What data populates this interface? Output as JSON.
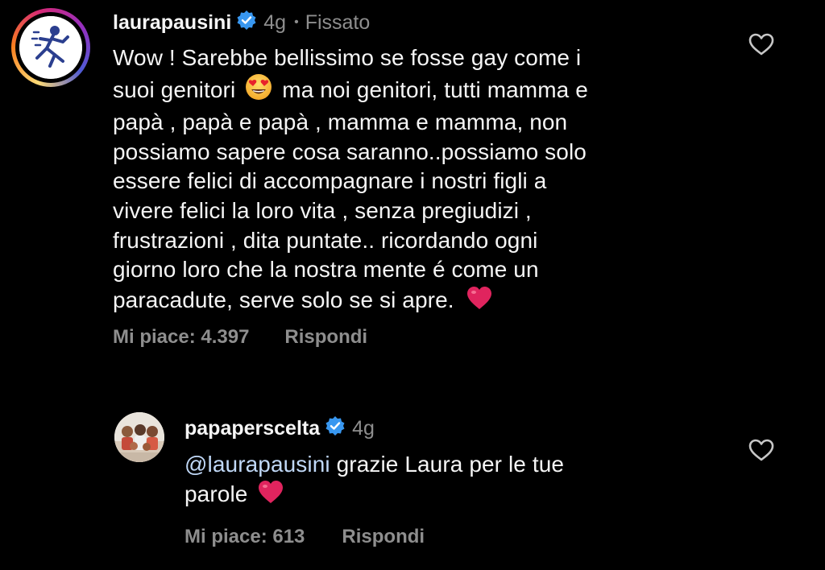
{
  "comments": [
    {
      "username": "laurapausini",
      "time": "4g",
      "separator": "•",
      "pinned_label": "Fissato",
      "text_lines": [
        "Wow ! Sarebbe bellissimo se fosse gay come i",
        "suoi genitori",
        "ma noi genitori, tutti mamma e",
        "papà , papà e papà , mamma e mamma, non",
        "possiamo sapere cosa saranno..possiamo solo",
        "essere felici di accompagnare i nostri figli a",
        "vivere felici la loro vita , senza pregiudizi ,",
        "frustrazioni , dita puntate.. ricordando ogni",
        "giorno loro che la nostra mente é come un",
        "paracadute, serve solo se si apre."
      ],
      "likes_label": "Mi piace: 4.397",
      "reply_label": "Rispondi",
      "icons": [
        "verified-badge-icon",
        "heart-eyes-emoji",
        "red-heart-emoji",
        "heart-outline-icon"
      ]
    },
    {
      "username": "papaperscelta",
      "time": "4g",
      "mention": "@laurapausini",
      "text_line1_rest": " grazie Laura per le tue",
      "text_line2": "parole",
      "likes_label": "Mi piace: 613",
      "reply_label": "Rispondi",
      "icons": [
        "verified-badge-icon",
        "red-heart-emoji",
        "heart-outline-icon"
      ]
    }
  ],
  "colors": {
    "background": "#000000",
    "text": "#f5f5f5",
    "secondary": "#8e8e8e",
    "verified": "#3897f0",
    "mention": "#c0d8f7",
    "heart": "#e0245e"
  }
}
